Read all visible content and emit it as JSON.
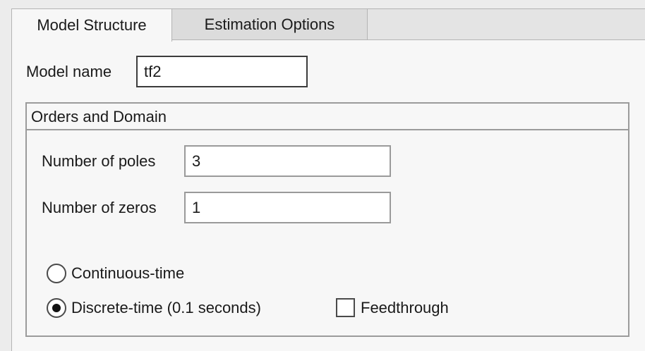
{
  "tabs": {
    "model_structure": "Model Structure",
    "estimation_options": "Estimation Options"
  },
  "model": {
    "name_label": "Model name",
    "name_value": "tf2"
  },
  "orders": {
    "group_title": "Orders and Domain",
    "poles_label": "Number of poles",
    "poles_value": "3",
    "zeros_label": "Number of zeros",
    "zeros_value": "1"
  },
  "domain": {
    "continuous_label": "Continuous-time",
    "continuous_selected": false,
    "discrete_label": "Discrete-time (0.1 seconds)",
    "discrete_selected": true,
    "feedthrough_label": "Feedthrough",
    "feedthrough_checked": false
  }
}
